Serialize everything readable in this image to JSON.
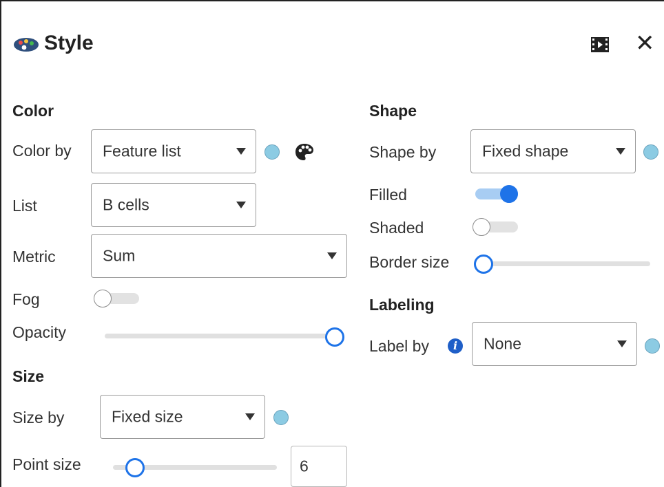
{
  "panel": {
    "title": "Style"
  },
  "color": {
    "heading": "Color",
    "color_by": {
      "label": "Color by",
      "value": "Feature list"
    },
    "list": {
      "label": "List",
      "value": "B cells"
    },
    "metric": {
      "label": "Metric",
      "value": "Sum"
    },
    "fog": {
      "label": "Fog",
      "on": false
    },
    "opacity": {
      "label": "Opacity",
      "level": 1.0
    }
  },
  "size": {
    "heading": "Size",
    "size_by": {
      "label": "Size by",
      "value": "Fixed size"
    },
    "point_size": {
      "label": "Point size",
      "value": "6",
      "level": 0.1
    }
  },
  "shape": {
    "heading": "Shape",
    "shape_by": {
      "label": "Shape by",
      "value": "Fixed shape"
    },
    "filled": {
      "label": "Filled",
      "on": true
    },
    "shaded": {
      "label": "Shaded",
      "on": false
    },
    "border_size": {
      "label": "Border size",
      "level": 0.0
    }
  },
  "labeling": {
    "heading": "Labeling",
    "label_by": {
      "label": "Label by",
      "value": "None"
    }
  },
  "icons": {
    "title": "palette-icon",
    "header_action": "film-icon",
    "close": "close-icon",
    "color_palette": "palette-icon",
    "info": "info-icon"
  },
  "colors": {
    "accent": "#1e73e8",
    "dot": "#8ccbe3",
    "track": "#e0e0e0"
  }
}
